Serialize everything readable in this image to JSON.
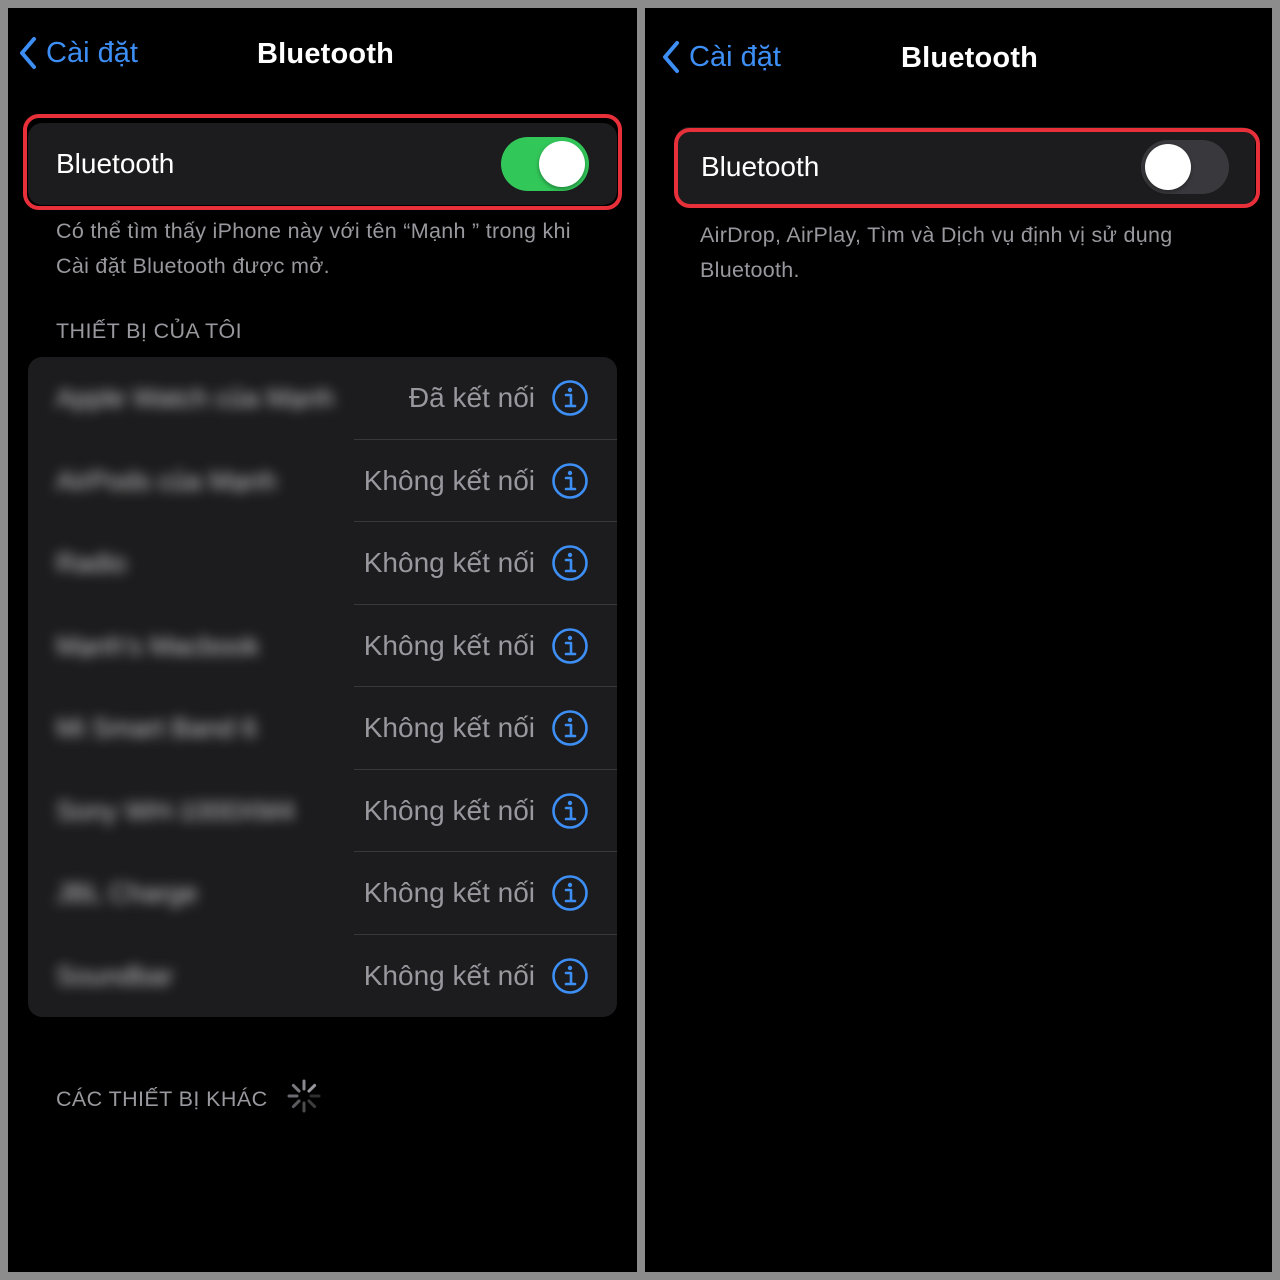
{
  "left_panel": {
    "nav": {
      "back_label": "Cài đặt",
      "title": "Bluetooth"
    },
    "toggle": {
      "label": "Bluetooth",
      "state": "on"
    },
    "footnote": "Có thể tìm thấy iPhone này với tên “Mạnh ” trong khi Cài đặt Bluetooth được mở.",
    "my_devices_header": "THIẾT BỊ CỦA TÔI",
    "devices": [
      {
        "name": "Apple Watch của Mạnh",
        "status": "Đã kết nối"
      },
      {
        "name": "AirPods của Mạnh",
        "status": "Không kết nối"
      },
      {
        "name": "Radio",
        "status": "Không kết nối"
      },
      {
        "name": "Mạnh's Macbook",
        "status": "Không kết nối"
      },
      {
        "name": "Mi Smart Band 6",
        "status": "Không kết nối"
      },
      {
        "name": "Sony WH-1000XM4",
        "status": "Không kết nối"
      },
      {
        "name": "JBL Charge",
        "status": "Không kết nối"
      },
      {
        "name": "Soundbar",
        "status": "Không kết nối"
      }
    ],
    "other_devices_header": "CÁC THIẾT BỊ KHÁC"
  },
  "right_panel": {
    "nav": {
      "back_label": "Cài đặt",
      "title": "Bluetooth"
    },
    "toggle": {
      "label": "Bluetooth",
      "state": "off"
    },
    "footnote": "AirDrop, AirPlay, Tìm và Dịch vụ định vị sử dụng Bluetooth."
  },
  "colors": {
    "accent": "#3d8ff5",
    "switch_on": "#32c759",
    "switch_off": "#39393d",
    "highlight": "#e8303a",
    "cell_background": "#1c1c1e",
    "secondary_text": "#98989e"
  }
}
